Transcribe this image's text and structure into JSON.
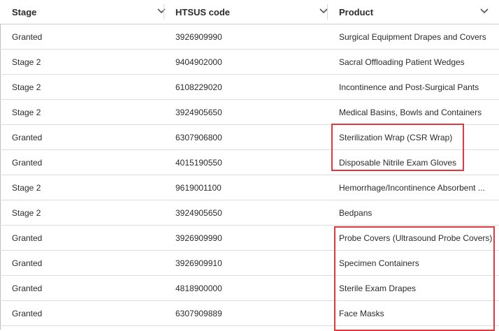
{
  "columns": [
    {
      "label": "Stage"
    },
    {
      "label": "HTSUS code"
    },
    {
      "label": "Product"
    }
  ],
  "rows": [
    {
      "stage": "Granted",
      "code": "3926909990",
      "product": "Surgical Equipment Drapes and Covers"
    },
    {
      "stage": "Stage 2",
      "code": "9404902000",
      "product": "Sacral Offloading Patient Wedges"
    },
    {
      "stage": "Stage 2",
      "code": "6108229020",
      "product": "Incontinence and Post-Surgical Pants"
    },
    {
      "stage": "Stage 2",
      "code": "3924905650",
      "product": "Medical Basins, Bowls and Containers"
    },
    {
      "stage": "Granted",
      "code": "6307906800",
      "product": "Sterilization Wrap (CSR Wrap)"
    },
    {
      "stage": "Granted",
      "code": "4015190550",
      "product": "Disposable Nitrile Exam Gloves"
    },
    {
      "stage": "Stage 2",
      "code": "9619001100",
      "product": "Hemorrhage/Incontinence Absorbent ..."
    },
    {
      "stage": "Stage 2",
      "code": "3924905650",
      "product": "Bedpans"
    },
    {
      "stage": "Granted",
      "code": "3926909990",
      "product": "Probe Covers (Ultrasound Probe Covers)"
    },
    {
      "stage": "Granted",
      "code": "3926909910",
      "product": "Specimen Containers"
    },
    {
      "stage": "Granted",
      "code": "4818900000",
      "product": "Sterile Exam Drapes"
    },
    {
      "stage": "Granted",
      "code": "6307909889",
      "product": "Face Masks"
    }
  ],
  "colors": {
    "highlight": "#e0393e",
    "text": "#2b2b2b",
    "divider": "#dcdcdc"
  },
  "icons": {
    "sort": "chevron-down-icon"
  }
}
